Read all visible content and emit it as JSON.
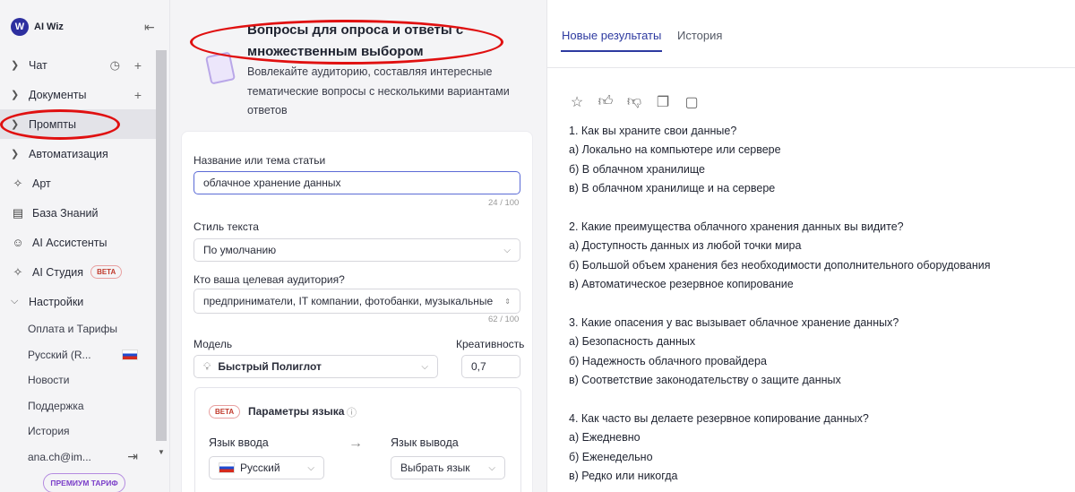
{
  "app": {
    "logo_text": "AI Wiz",
    "logo_mark": "W"
  },
  "sidebar": {
    "items": [
      {
        "label": "Чат",
        "type": "expand"
      },
      {
        "label": "Документы",
        "type": "expand"
      },
      {
        "label": "Промпты",
        "type": "expand"
      },
      {
        "label": "Автоматизация",
        "type": "expand"
      },
      {
        "label": "Арт",
        "icon": "sparkle-icon"
      },
      {
        "label": "База Знаний",
        "icon": "book-icon"
      },
      {
        "label": "AI Ассистенты",
        "icon": "robot-icon"
      },
      {
        "label": "AI Студия",
        "icon": "sparkle-icon",
        "badge": "BETA"
      },
      {
        "label": "Настройки",
        "type": "expanded"
      }
    ],
    "sub_items": [
      "Оплата и Тарифы",
      "Русский (R...",
      "Новости",
      "Поддержка",
      "История",
      "ana.ch@im..."
    ],
    "premium_label": "ПРЕМИУМ ТАРИФ"
  },
  "tool": {
    "title": "Вопросы для опроса и ответы с множественным выбором",
    "description": "Вовлекайте аудиторию, составляя интересные тематические вопросы с несколькими вариантами ответов"
  },
  "form": {
    "topic_label": "Название или тема статьи",
    "topic_value": "облачное хранение данных",
    "topic_counter": "24 / 100",
    "style_label": "Стиль текста",
    "style_value": "По умолчанию",
    "audience_label": "Кто ваша целевая аудитория?",
    "audience_value": "предприниматели, IT компании, фотобанки, музыкальные",
    "audience_counter": "62 / 100",
    "model_label": "Модель",
    "model_value": "Быстрый Полиглот",
    "creativity_label": "Креативность",
    "creativity_value": "0,7",
    "lang_badge": "BETA",
    "lang_title": "Параметры языка",
    "input_lang_label": "Язык ввода",
    "input_lang_value": "Русский",
    "output_lang_label": "Язык вывода",
    "output_lang_value": "Выбрать язык"
  },
  "tabs": {
    "new_results": "Новые результаты",
    "history": "История"
  },
  "results": [
    "1. Как вы храните свои данные?",
    "а) Локально на компьютере или сервере",
    "б) В облачном хранилище",
    "в) В облачном хранилище и на сервере",
    "",
    "2. Какие преимущества облачного хранения данных вы видите?",
    "а) Доступность данных из любой точки мира",
    "б) Большой объем хранения без необходимости дополнительного оборудования",
    "в) Автоматическое резервное копирование",
    "",
    "3. Какие опасения у вас вызывает облачное хранение данных?",
    "а) Безопасность данных",
    "б) Надежность облачного провайдера",
    "в) Соответствие законодательству о защите данных",
    "",
    "4. Как часто вы делаете резервное копирование данных?",
    "а) Ежедневно",
    "б) Еженедельно",
    "в) Редко или никогда"
  ]
}
